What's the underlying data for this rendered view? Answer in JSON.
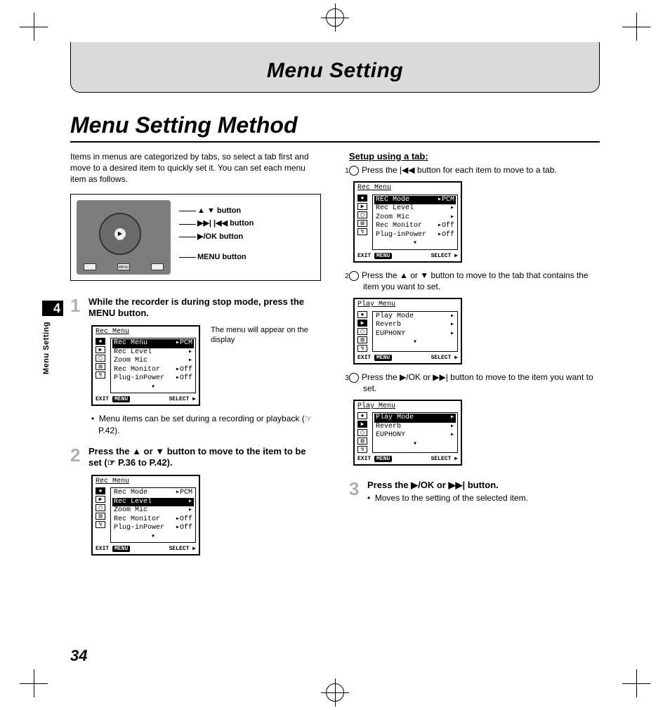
{
  "banner": {
    "title": "Menu Setting"
  },
  "section_title": "Menu Setting Method",
  "intro": "Items in menus are categorized by tabs, so select a tab first and move to a desired item to quickly set it. You can set each menu item as follows.",
  "device_callouts": {
    "nav_ud": "▲ ▼ button",
    "nav_lr": "▶▶| |◀◀ button",
    "ok": "▶/OK button",
    "menu": "MENU button"
  },
  "margin_tab": {
    "number": "4",
    "label": "Menu Setting"
  },
  "steps": {
    "s1": {
      "num": "1",
      "text": "While the recorder is during stop mode, press the MENU button.",
      "note": "The menu will appear on the display",
      "bullet": "Menu items can be set during a recording or playback (☞ P.42)."
    },
    "s2": {
      "num": "2",
      "text": "Press the ▲ or ▼ button to move to the item to be set (☞ P.36 to P.42)."
    },
    "s3": {
      "num": "3",
      "text": "Press the ▶/OK or ▶▶| button.",
      "bullet": "Moves to the setting of the selected item."
    }
  },
  "right": {
    "subhead": "Setup using a tab:",
    "i1": "Press the |◀◀ button for each item to move to a tab.",
    "i2": "Press the ▲ or ▼ button to move to the tab that contains the item you want to set.",
    "i3": "Press the ▶/OK or ▶▶| button to move to the item you want to set."
  },
  "lcd_common": {
    "exit": "EXIT",
    "menu": "MENU",
    "select": "SELECT ▶"
  },
  "lcd1": {
    "title": "Rec Menu",
    "rows": [
      {
        "l": "Rec Menu",
        "r": "▸PCM",
        "hl": true
      },
      {
        "l": "Rec Level",
        "r": "▸",
        "hl": false
      },
      {
        "l": "Zoom Mic",
        "r": "▸",
        "hl": false
      },
      {
        "l": "Rec Monitor",
        "r": "▸Off",
        "hl": false
      },
      {
        "l": "Plug-inPower",
        "r": "▸Off",
        "hl": false
      }
    ]
  },
  "lcd2": {
    "title": "Rec Menu",
    "rows": [
      {
        "l": "Rec Mode",
        "r": "▸PCM",
        "hl": false
      },
      {
        "l": "Rec Level",
        "r": "▸",
        "hl": true
      },
      {
        "l": "Zoom Mic",
        "r": "▸",
        "hl": false
      },
      {
        "l": "Rec Monitor",
        "r": "▸Off",
        "hl": false
      },
      {
        "l": "Plug-inPower",
        "r": "▸Off",
        "hl": false
      }
    ]
  },
  "lcd3": {
    "title": "Rec Menu",
    "rows": [
      {
        "l": "REC Mode",
        "r": "▸PCM",
        "hl": true
      },
      {
        "l": "Rec Level",
        "r": "▸",
        "hl": false
      },
      {
        "l": "Zoom Mic",
        "r": "▸",
        "hl": false
      },
      {
        "l": "Rec Monitor",
        "r": "▸Off",
        "hl": false
      },
      {
        "l": "Plug-inPower",
        "r": "▸Off",
        "hl": false
      }
    ]
  },
  "lcd4": {
    "title": "Play Menu",
    "rows": [
      {
        "l": "Play Mode",
        "r": "▸",
        "hl": false
      },
      {
        "l": "Reverb",
        "r": "▸",
        "hl": false
      },
      {
        "l": "EUPHONY",
        "r": "▸",
        "hl": false
      }
    ]
  },
  "lcd5": {
    "title": "Play Menu",
    "rows": [
      {
        "l": "Play Mode",
        "r": "▸",
        "hl": true
      },
      {
        "l": "Reverb",
        "r": "▸",
        "hl": false
      },
      {
        "l": "EUPHONY",
        "r": "▸",
        "hl": false
      }
    ]
  },
  "page_number": "34"
}
